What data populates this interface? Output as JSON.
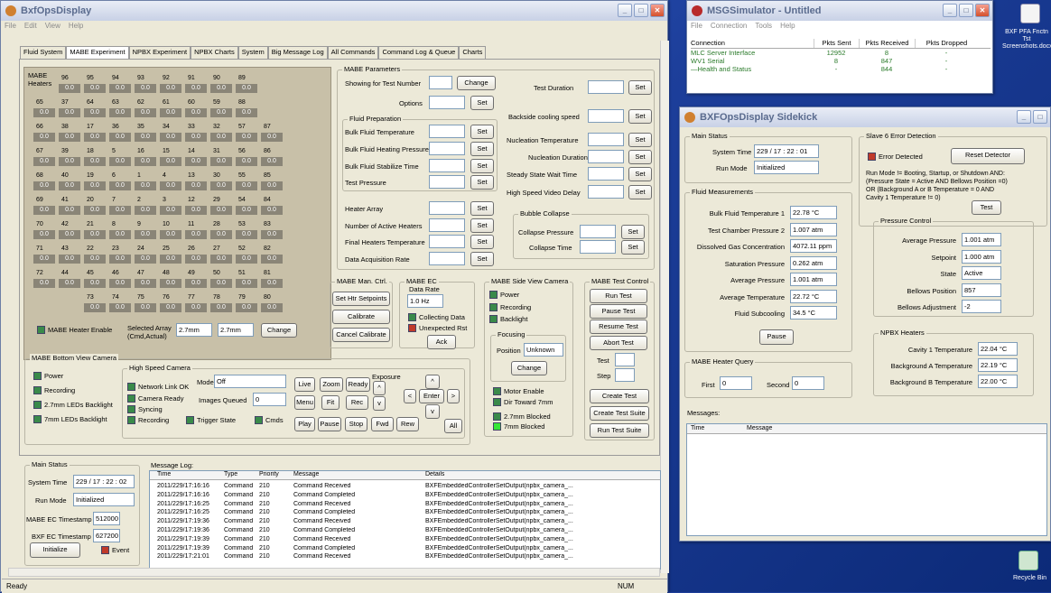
{
  "main": {
    "title": "BxfOpsDisplay",
    "menu": [
      "File",
      "Edit",
      "View",
      "Help"
    ],
    "tabs": [
      "Fluid System",
      "MABE Experiment",
      "NPBX Experiment",
      "NPBX Charts",
      "System",
      "Big Message Log",
      "All Commands",
      "Command Log & Queue",
      "Charts"
    ],
    "heaters_label": "MABE\nHeaters",
    "heater_rows": [
      {
        "offset": 1,
        "nums": [
          "96",
          "95",
          "94",
          "93",
          "92",
          "91",
          "90",
          "89"
        ]
      },
      {
        "offset": 0,
        "nums": [
          "65",
          "37",
          "64",
          "63",
          "62",
          "61",
          "60",
          "59",
          "88"
        ]
      },
      {
        "offset": 0,
        "nums": [
          "66",
          "38",
          "17",
          "36",
          "35",
          "34",
          "33",
          "32",
          "57",
          "87"
        ]
      },
      {
        "offset": 0,
        "nums": [
          "67",
          "39",
          "18",
          "5",
          "16",
          "15",
          "14",
          "31",
          "56",
          "86"
        ]
      },
      {
        "offset": 0,
        "nums": [
          "68",
          "40",
          "19",
          "6",
          "1",
          "4",
          "13",
          "30",
          "55",
          "85"
        ]
      },
      {
        "offset": 0,
        "nums": [
          "69",
          "41",
          "20",
          "7",
          "2",
          "3",
          "12",
          "29",
          "54",
          "84"
        ]
      },
      {
        "offset": 0,
        "nums": [
          "70",
          "42",
          "21",
          "8",
          "9",
          "10",
          "11",
          "28",
          "53",
          "83"
        ]
      },
      {
        "offset": 0,
        "nums": [
          "71",
          "43",
          "22",
          "23",
          "24",
          "25",
          "26",
          "27",
          "52",
          "82"
        ]
      },
      {
        "offset": 0,
        "nums": [
          "72",
          "44",
          "45",
          "46",
          "47",
          "48",
          "49",
          "50",
          "51",
          "81"
        ]
      },
      {
        "offset": 2,
        "nums": [
          "73",
          "74",
          "75",
          "76",
          "77",
          "78",
          "79",
          "80"
        ]
      }
    ],
    "heater_value": "0.0",
    "heater_enable": "MABE Heater Enable",
    "sel_array": "Selected Array\n(Cmd,Actual)",
    "sel_cmd": "2.7mm",
    "sel_actual": "2.7mm",
    "change": "Change",
    "params": {
      "title": "MABE Parameters",
      "showing": "Showing for Test Number",
      "change": "Change",
      "options": "Options",
      "set": "Set",
      "fluid_prep": "Fluid Preparation",
      "bulk_temp": "Bulk Fluid Temperature",
      "bulk_press": "Bulk Fluid Heating Pressure",
      "bulk_stab": "Bulk Fluid Stabilize Time",
      "test_press": "Test Pressure",
      "heater_array": "Heater Array",
      "num_heaters": "Number of Active Heaters",
      "final_temp": "Final Heaters Temperature",
      "daq": "Data Acquisition Rate",
      "test_dur": "Test Duration",
      "backside": "Backside cooling speed",
      "nuc_temp": "Nucleation Temperature",
      "nuc_dur": "Nucleation Duration",
      "steady": "Steady State Wait Time",
      "hsv_delay": "High Speed Video Delay",
      "bubble": "Bubble Collapse",
      "col_press": "Collapse Pressure",
      "col_time": "Collapse Time"
    },
    "manctrl": {
      "title": "MABE Man. Ctrl.",
      "set_hs": "Set Htr Setpoints",
      "calibrate": "Calibrate",
      "cancel_cal": "Cancel Calibrate"
    },
    "ec": {
      "title": "MABE EC",
      "rate_label": "Data Rate",
      "rate": "1.0 Hz",
      "collecting": "Collecting Data",
      "unexpected": "Unexpected Rst",
      "ack": "Ack"
    },
    "side": {
      "title": "MABE Side View Camera",
      "power": "Power",
      "recording": "Recording",
      "backlight": "Backlight",
      "focusing": "Focusing",
      "position": "Position",
      "pos_val": "Unknown",
      "change": "Change",
      "motor": "Motor Enable",
      "dir": "Dir Toward 7mm",
      "b27": "2.7mm Blocked",
      "b7": "7mm Blocked"
    },
    "testctl": {
      "title": "MABE Test Control",
      "run": "Run Test",
      "pause": "Pause Test",
      "resume": "Resume Test",
      "abort": "Abort Test",
      "test": "Test",
      "step": "Step",
      "create": "Create Test",
      "create_suite": "Create Test Suite",
      "run_suite": "Run Test Suite"
    },
    "bottom": {
      "title": "MABE Bottom View Camera",
      "power": "Power",
      "recording": "Recording",
      "led27": "2.7mm LEDs Backlight",
      "led7": "7mm LEDs Backlight"
    },
    "hsc": {
      "title": "High Speed Camera",
      "netlink": "Network Link OK",
      "ready": "Camera Ready",
      "syncing": "Syncing",
      "recording": "Recording",
      "trigger": "Trigger State",
      "cmds": "Cmds",
      "mode": "Mode",
      "mode_val": "Off",
      "queued": "Images Queued",
      "queued_val": "0",
      "live": "Live",
      "zoom": "Zoom",
      "ready_btn": "Ready",
      "exposure": "Exposure",
      "menu": "Menu",
      "fit": "Fit",
      "rec": "Rec",
      "play": "Play",
      "pause": "Pause",
      "stop": "Stop",
      "fwd": "Fwd",
      "rew": "Rew",
      "enter": "Enter",
      "all": "All"
    },
    "status": {
      "title": "Main Status",
      "systime": "System Time",
      "systime_val": "229 / 17 : 22 : 02",
      "runmode": "Run Mode",
      "runmode_val": "Initialized",
      "mabe_ts": "MABE EC Timestamp",
      "mabe_ts_val": "512000",
      "bxf_ts": "BXF EC Timestamp",
      "bxf_ts_val": "627200",
      "init": "Initialize",
      "event": "Event"
    },
    "log": {
      "title": "Message Log:",
      "cols": [
        "Time",
        "Type",
        "Priority",
        "Message",
        "Details"
      ],
      "rows": [
        [
          "2011/229/17:16:16",
          "Command",
          "210",
          "Command Received",
          "BXFEmbeddedControllerSetOutput(npbx_camera_..."
        ],
        [
          "2011/229/17:16:16",
          "Command",
          "210",
          "Command Completed",
          "BXFEmbeddedControllerSetOutput(npbx_camera_..."
        ],
        [
          "2011/229/17:16:25",
          "Command",
          "210",
          "Command Received",
          "BXFEmbeddedControllerSetOutput(npbx_camera_..."
        ],
        [
          "2011/229/17:16:25",
          "Command",
          "210",
          "Command Completed",
          "BXFEmbeddedControllerSetOutput(npbx_camera_..."
        ],
        [
          "2011/229/17:19:36",
          "Command",
          "210",
          "Command Received",
          "BXFEmbeddedControllerSetOutput(npbx_camera_..."
        ],
        [
          "2011/229/17:19:36",
          "Command",
          "210",
          "Command Completed",
          "BXFEmbeddedControllerSetOutput(npbx_camera_..."
        ],
        [
          "2011/229/17:19:39",
          "Command",
          "210",
          "Command Received",
          "BXFEmbeddedControllerSetOutput(npbx_camera_..."
        ],
        [
          "2011/229/17:19:39",
          "Command",
          "210",
          "Command Completed",
          "BXFEmbeddedControllerSetOutput(npbx_camera_..."
        ],
        [
          "2011/229/17:21:01",
          "Command",
          "210",
          "Command Received",
          "BXFEmbeddedControllerSetOutput(npbx_camera_..."
        ]
      ]
    },
    "statusbar": {
      "ready": "Ready",
      "num": "NUM"
    }
  },
  "msg": {
    "title": "MSGSimulator - Untitled",
    "menu": [
      "File",
      "Connection",
      "Tools",
      "Help"
    ],
    "cols": [
      "Connection",
      "Pkts Sent",
      "Pkts Received",
      "Pkts Dropped"
    ],
    "rows": [
      [
        "MLC Server Interface",
        "12952",
        "8",
        "-"
      ],
      [
        "WV1 Serial",
        "8",
        "847",
        "-"
      ],
      [
        "—Health and Status",
        "-",
        "844",
        "-"
      ]
    ]
  },
  "side": {
    "title": "BXFOpsDisplay Sidekick",
    "main": {
      "title": "Main Status",
      "systime": "System Time",
      "systime_val": "229 / 17 : 22 : 01",
      "runmode": "Run Mode",
      "runmode_val": "Initialized"
    },
    "fluid": {
      "title": "Fluid Measurements",
      "rows": [
        [
          "Bulk Fluid Temperature 1",
          "22.78 °C"
        ],
        [
          "Test Chamber Pressure 2",
          "1.007 atm"
        ],
        [
          "Dissolved Gas Concentration",
          "4072.11 ppm"
        ],
        [
          "Saturation Pressure",
          "0.262 atm"
        ],
        [
          "Average Pressure",
          "1.001 atm"
        ],
        [
          "Average Temperature",
          "22.72 °C"
        ],
        [
          "Fluid Subcooling",
          "34.5 °C"
        ]
      ],
      "pause": "Pause"
    },
    "query": {
      "title": "MABE Heater Query",
      "first": "First",
      "first_val": "0",
      "second": "Second",
      "second_val": "0"
    },
    "slave": {
      "title": "Slave 6 Error Detection",
      "err": "Error Detected",
      "reset": "Reset Detector",
      "desc": "Run Mode != Booting, Startup, or Shutdown AND:\n(Pressure State = Active AND Bellows Position =0)\nOR (Background A or B Temperature = 0 AND\nCavity 1 Temperature != 0)",
      "test": "Test"
    },
    "pc": {
      "title": "Pressure Control",
      "rows": [
        [
          "Average Pressure",
          "1.001 atm"
        ],
        [
          "Setpoint",
          "1.000 atm"
        ],
        [
          "State",
          "Active"
        ],
        [
          "Bellows Position",
          "857"
        ],
        [
          "Bellows Adjustment",
          "-2"
        ]
      ]
    },
    "npbx": {
      "title": "NPBX Heaters",
      "rows": [
        [
          "Cavity 1 Temperature",
          "22.04 °C"
        ],
        [
          "Background A Temperature",
          "22.19 °C"
        ],
        [
          "Background B Temperature",
          "22.00 °C"
        ]
      ]
    },
    "messages": "Messages:",
    "mcols": [
      "Time",
      "Message"
    ]
  },
  "desktop": {
    "icon1": "BXF PFA Fnctn Tst Screenshots.docx",
    "recycle": "Recycle Bin"
  }
}
